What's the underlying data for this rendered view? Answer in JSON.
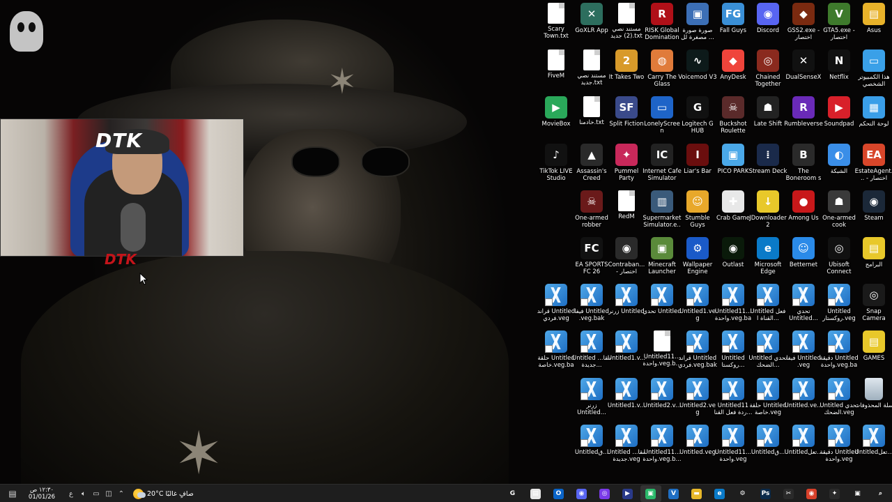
{
  "desktop": {
    "icons": [
      {
        "label": "Scary Town.txt",
        "type": "doc",
        "color": "#ffffff",
        "glyph": ""
      },
      {
        "label": "GoXLR App",
        "type": "app",
        "color": "#2d6e5e",
        "glyph": "✕"
      },
      {
        "label": "مستند نصي (2) جديد.txt",
        "type": "doc",
        "color": "#ffffff",
        "glyph": ""
      },
      {
        "label": "RISK Global Domination",
        "type": "app",
        "color": "#b01018",
        "glyph": "R"
      },
      {
        "label": "صورة صورة مصغرة لل ...",
        "type": "app",
        "color": "#3c6fb6",
        "glyph": "▣"
      },
      {
        "label": "Fall Guys",
        "type": "app",
        "color": "#3a8fd6",
        "glyph": "FG"
      },
      {
        "label": "Discord",
        "type": "app",
        "color": "#5865f2",
        "glyph": "◉"
      },
      {
        "label": "GSS2.exe - اختصار",
        "type": "app",
        "color": "#7a2a10",
        "glyph": "◆"
      },
      {
        "label": "GTA5.exe - اختصار",
        "type": "app",
        "color": "#3e7a2c",
        "glyph": "V"
      },
      {
        "label": "Asus",
        "type": "app",
        "color": "#e8b22a",
        "glyph": "▤"
      },
      {
        "label": "FiveM",
        "type": "doc",
        "color": "#ffffff",
        "glyph": ""
      },
      {
        "label": "مستند نصي جديد.txt",
        "type": "doc",
        "color": "#ffffff",
        "glyph": ""
      },
      {
        "label": "It Takes Two",
        "type": "app",
        "color": "#d89a2a",
        "glyph": "2"
      },
      {
        "label": "Carry The Glass",
        "type": "app",
        "color": "#e07b3a",
        "glyph": "◍"
      },
      {
        "label": "Voicemod V3",
        "type": "app",
        "color": "#0d1a1a",
        "glyph": "∿"
      },
      {
        "label": "AnyDesk",
        "type": "app",
        "color": "#ef443b",
        "glyph": "◆"
      },
      {
        "label": "Chained Together",
        "type": "app",
        "color": "#8a2a1e",
        "glyph": "◎"
      },
      {
        "label": "DualSenseX",
        "type": "app",
        "color": "#111111",
        "glyph": "✕"
      },
      {
        "label": "Netflix",
        "type": "app",
        "color": "#111111",
        "glyph": "N"
      },
      {
        "label": "هذا الكمبيوتر الشخصي",
        "type": "app",
        "color": "#3aa0e8",
        "glyph": "▭"
      },
      {
        "label": "MovieBox",
        "type": "app",
        "color": "#2aa85a",
        "glyph": "▶"
      },
      {
        "label": "خادمنا.txt",
        "type": "doc",
        "color": "#ffffff",
        "glyph": ""
      },
      {
        "label": "Split Fiction",
        "type": "app",
        "color": "#3a4a8a",
        "glyph": "SF"
      },
      {
        "label": "LonelyScreen",
        "type": "app",
        "color": "#1e64c8",
        "glyph": "▭"
      },
      {
        "label": "Logitech G HUB",
        "type": "app",
        "color": "#111111",
        "glyph": "G"
      },
      {
        "label": "Buckshot Roulette",
        "type": "app",
        "color": "#5a2a2a",
        "glyph": "☠"
      },
      {
        "label": "Late Shift",
        "type": "app",
        "color": "#222222",
        "glyph": "☗"
      },
      {
        "label": "Rumbleverse",
        "type": "app",
        "color": "#6a2ab8",
        "glyph": "R"
      },
      {
        "label": "Soundpad",
        "type": "app",
        "color": "#d8202a",
        "glyph": "▶"
      },
      {
        "label": "لوحة التحكم",
        "type": "app",
        "color": "#3a9ee8",
        "glyph": "▦"
      },
      {
        "label": "TikTok LIVE Studio",
        "type": "app",
        "color": "#111111",
        "glyph": "♪"
      },
      {
        "label": "Assassin's Creed Mirage",
        "type": "app",
        "color": "#2a2a2a",
        "glyph": "▲"
      },
      {
        "label": "Pummel Party",
        "type": "app",
        "color": "#c8285a",
        "glyph": "✦"
      },
      {
        "label": "Internet Cafe Simulator 2...",
        "type": "app",
        "color": "#222222",
        "glyph": "IC"
      },
      {
        "label": "Liar's Bar",
        "type": "app",
        "color": "#6a0e0e",
        "glyph": "Ⅰ"
      },
      {
        "label": "PICO PARK",
        "type": "app",
        "color": "#4aa8e8",
        "glyph": "▣"
      },
      {
        "label": "Stream Deck",
        "type": "app",
        "color": "#1a2a4a",
        "glyph": "⁞"
      },
      {
        "label": "The Boneroom s",
        "type": "app",
        "color": "#2a2a2a",
        "glyph": "B"
      },
      {
        "label": "الشبكة",
        "type": "app",
        "color": "#3a8ee8",
        "glyph": "◐"
      },
      {
        "label": "EstateAgent... - اختصار",
        "type": "app",
        "color": "#d8462a",
        "glyph": "EA"
      },
      {
        "label": "One-armed robber",
        "type": "app",
        "color": "#6a1a1a",
        "glyph": "☠"
      },
      {
        "label": "RedM",
        "type": "doc",
        "color": "#ffffff",
        "glyph": ""
      },
      {
        "label": "Supermarket Simulator.e...",
        "type": "app",
        "color": "#3a5a7a",
        "glyph": "▥"
      },
      {
        "label": "Stumble Guys",
        "type": "app",
        "color": "#e8a82a",
        "glyph": "☺"
      },
      {
        "label": "Crab Game",
        "type": "app",
        "color": "#e8e8e8",
        "glyph": "✚"
      },
      {
        "label": "JDownloader 2",
        "type": "app",
        "color": "#e8c82a",
        "glyph": "↓"
      },
      {
        "label": "Among Us",
        "type": "app",
        "color": "#c8181a",
        "glyph": "●"
      },
      {
        "label": "One-armed cook",
        "type": "app",
        "color": "#3a3a3a",
        "glyph": "☗"
      },
      {
        "label": "Steam",
        "type": "app",
        "color": "#1b2838",
        "glyph": "◉"
      },
      {
        "label": "EA SPORTS FC 26",
        "type": "app",
        "color": "#111111",
        "glyph": "FC"
      },
      {
        "label": "Contraban... - اختصار",
        "type": "app",
        "color": "#2a2a2a",
        "glyph": "◉"
      },
      {
        "label": "Minecraft Launcher",
        "type": "app",
        "color": "#5a8a3a",
        "glyph": "▣"
      },
      {
        "label": "Wallpaper Engine",
        "type": "app",
        "color": "#1a5ac8",
        "glyph": "⚙"
      },
      {
        "label": "Outlast",
        "type": "app",
        "color": "#0a1a0a",
        "glyph": "◉"
      },
      {
        "label": "Microsoft Edge",
        "type": "app",
        "color": "#0a7ac8",
        "glyph": "e"
      },
      {
        "label": "Betternet",
        "type": "app",
        "color": "#2a8ae8",
        "glyph": "☺"
      },
      {
        "label": "Ubisoft Connect",
        "type": "app",
        "color": "#111111",
        "glyph": "◎"
      },
      {
        "label": "البرامج",
        "type": "app",
        "color": "#e8c82a",
        "glyph": "▤"
      },
      {
        "label": "قراند Untitled فردي.veg",
        "type": "veg",
        "color": "",
        "glyph": ""
      },
      {
        "label": "فيفا Untitled .veg.bak",
        "type": "veg",
        "color": "",
        "glyph": ""
      },
      {
        "label": "زرنر Untitled",
        "type": "veg",
        "color": "",
        "glyph": ""
      },
      {
        "label": "تحدي Untitled",
        "type": "veg",
        "color": "",
        "glyph": ""
      },
      {
        "label": "Untitled1.veg",
        "type": "veg",
        "color": "",
        "glyph": ""
      },
      {
        "label": "Untitled11... واحدة.veg.bak",
        "type": "veg",
        "color": "",
        "glyph": ""
      },
      {
        "label": "Untitled فعل القناة ا...",
        "type": "veg",
        "color": "",
        "glyph": ""
      },
      {
        "label": "تحدي Untitled...",
        "type": "veg",
        "color": "",
        "glyph": ""
      },
      {
        "label": "Untitled روكستار.veg",
        "type": "veg",
        "color": "",
        "glyph": ""
      },
      {
        "label": "Snap Camera",
        "type": "app",
        "color": "#1a1a1a",
        "glyph": "◎"
      },
      {
        "label": "حلقة Untitled خاصة.veg.bak",
        "type": "veg",
        "color": "",
        "glyph": ""
      },
      {
        "label": "Untitled مقا... جديدة...",
        "type": "veg",
        "color": "",
        "glyph": ""
      },
      {
        "label": "Untitled1.v...",
        "type": "veg",
        "color": "",
        "glyph": ""
      },
      {
        "label": "Untitled11... واحدة.veg.b...",
        "type": "doc",
        "color": "#ffffff",
        "glyph": ""
      },
      {
        "label": "قراند Untitled فردي.veg.bak",
        "type": "veg",
        "color": "",
        "glyph": ""
      },
      {
        "label": "Untitled روكستا...",
        "type": "veg",
        "color": "",
        "glyph": ""
      },
      {
        "label": "Untitled تحدي الضحك...",
        "type": "veg",
        "color": "",
        "glyph": ""
      },
      {
        "label": "فيفا Untitled .veg",
        "type": "veg",
        "color": "",
        "glyph": ""
      },
      {
        "label": "دقيقة Untitled واحدة.veg.bak",
        "type": "veg",
        "color": "",
        "glyph": ""
      },
      {
        "label": "GAMES",
        "type": "app",
        "color": "#e8c82a",
        "glyph": "▤"
      },
      {
        "label": "زرنر Untitled...",
        "type": "veg",
        "color": "",
        "glyph": ""
      },
      {
        "label": "Untitled1.v...",
        "type": "veg",
        "color": "",
        "glyph": ""
      },
      {
        "label": "Untitled2.v...",
        "type": "veg",
        "color": "",
        "glyph": ""
      },
      {
        "label": "Untitled2.veg",
        "type": "veg",
        "color": "",
        "glyph": ""
      },
      {
        "label": "Untitled11 ردة فعل القنا...",
        "type": "veg",
        "color": "",
        "glyph": ""
      },
      {
        "label": "حلقة Untitled خاصة.veg",
        "type": "veg",
        "color": "",
        "glyph": ""
      },
      {
        "label": "Untitled.ve...",
        "type": "veg",
        "color": "",
        "glyph": ""
      },
      {
        "label": "Untitled تحدي الضحك.veg",
        "type": "veg",
        "color": "",
        "glyph": ""
      },
      {
        "label": "سلة المحذوفات",
        "type": "recycle",
        "color": "",
        "glyph": ""
      },
      {
        "label": "Untitledق...",
        "type": "veg",
        "color": "",
        "glyph": ""
      },
      {
        "label": "Untitled مقا... جديدة.veg",
        "type": "veg",
        "color": "",
        "glyph": ""
      },
      {
        "label": "Untitled11... واحدة.veg.b...",
        "type": "veg",
        "color": "",
        "glyph": ""
      },
      {
        "label": "Untitled.veg",
        "type": "veg",
        "color": "",
        "glyph": ""
      },
      {
        "label": "Untitled11... واحدة.veg",
        "type": "veg",
        "color": "",
        "glyph": ""
      },
      {
        "label": "Untitledق...",
        "type": "veg",
        "color": "",
        "glyph": ""
      },
      {
        "label": "Untitledتعل...",
        "type": "veg",
        "color": "",
        "glyph": ""
      },
      {
        "label": "دقيقة Untitled واحدة.veg",
        "type": "veg",
        "color": "",
        "glyph": ""
      },
      {
        "label": "Untitledتعل...",
        "type": "veg",
        "color": "",
        "glyph": ""
      }
    ]
  },
  "webcam": {
    "overlay_text": "DTK",
    "tag_text": "DTK"
  },
  "taskbar": {
    "time": "١٢:٣٠ ص",
    "date": "01/01/26",
    "lang": "ع",
    "weather_temp": "20°C",
    "weather_text": "صافٍ غالبًا",
    "tray_icons": [
      "speaker-icon",
      "network-icon",
      "battery-icon",
      "chevron-up-icon"
    ],
    "apps": [
      {
        "name": "search-icon",
        "glyph": "⌕",
        "color": "transparent"
      },
      {
        "name": "task-view-icon",
        "glyph": "▣",
        "color": "transparent"
      },
      {
        "name": "chatgpt-icon",
        "glyph": "✦",
        "color": "#2a2a2a"
      },
      {
        "name": "chrome-icon",
        "glyph": "◉",
        "color": "#d8402a"
      },
      {
        "name": "capcut-icon",
        "glyph": "✂",
        "color": "#2a2a2a"
      },
      {
        "name": "photoshop-icon",
        "glyph": "Ps",
        "color": "#0a2a4a"
      },
      {
        "name": "settings-icon",
        "glyph": "⚙",
        "color": "transparent"
      },
      {
        "name": "edge-icon",
        "glyph": "e",
        "color": "#0a7ac8"
      },
      {
        "name": "file-explorer-icon",
        "glyph": "▬",
        "color": "#e8b82a"
      },
      {
        "name": "vegas-icon",
        "glyph": "V",
        "color": "#1f6fc4"
      },
      {
        "name": "app-active-icon",
        "glyph": "▣",
        "color": "#2ab86a"
      },
      {
        "name": "media-player-icon",
        "glyph": "▶",
        "color": "#2a3a8a"
      },
      {
        "name": "twitch-icon",
        "glyph": "◎",
        "color": "#7a3ae8"
      },
      {
        "name": "discord-icon",
        "glyph": "◉",
        "color": "#5865f2"
      },
      {
        "name": "outlook-icon",
        "glyph": "O",
        "color": "#0a64c8"
      },
      {
        "name": "notepad-icon",
        "glyph": "▤",
        "color": "#e8e8e8"
      },
      {
        "name": "gskill-icon",
        "glyph": "G",
        "color": "transparent"
      }
    ]
  }
}
